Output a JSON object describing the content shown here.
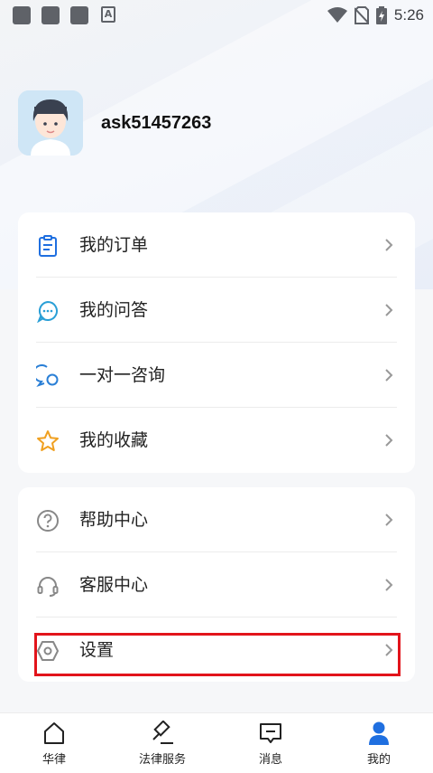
{
  "status_bar": {
    "time": "5:26",
    "notification_letter": "A"
  },
  "profile": {
    "username": "ask51457263"
  },
  "menu_group_1": [
    {
      "label": "我的订单",
      "icon": "clipboard-icon"
    },
    {
      "label": "我的问答",
      "icon": "chat-bubble-icon"
    },
    {
      "label": "一对一咨询",
      "icon": "consult-bubbles-icon"
    },
    {
      "label": "我的收藏",
      "icon": "star-icon"
    }
  ],
  "menu_group_2": [
    {
      "label": "帮助中心",
      "icon": "help-circle-icon"
    },
    {
      "label": "客服中心",
      "icon": "headset-icon"
    },
    {
      "label": "设置",
      "icon": "hexagon-settings-icon"
    }
  ],
  "tabbar": [
    {
      "label": "华律",
      "icon": "home-icon"
    },
    {
      "label": "法律服务",
      "icon": "gavel-icon"
    },
    {
      "label": "消息",
      "icon": "message-icon"
    },
    {
      "label": "我的",
      "icon": "person-icon",
      "active": true
    }
  ],
  "colors": {
    "blue_accent": "#1f6fe0",
    "star": "#f0a020",
    "highlight": "#e2141b"
  }
}
